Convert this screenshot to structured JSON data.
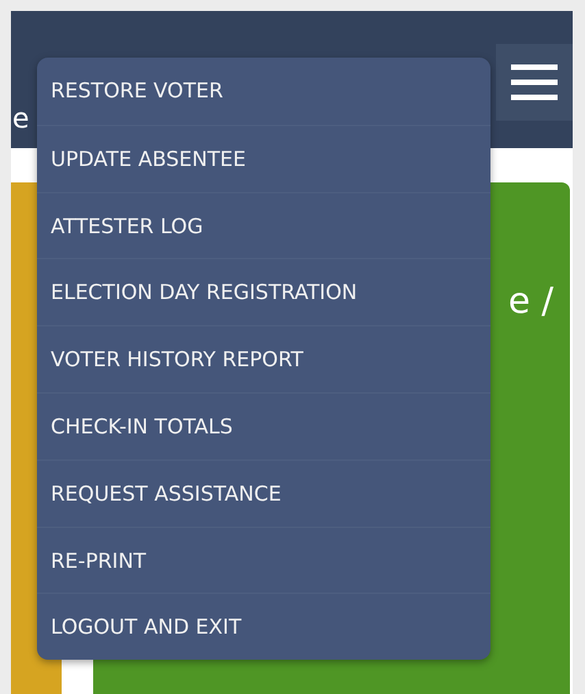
{
  "header": {
    "title_fragment": "e"
  },
  "content": {
    "card_text_fragment": "e /"
  },
  "menu": {
    "items": [
      {
        "label": "RESTORE VOTER"
      },
      {
        "label": "UPDATE ABSENTEE"
      },
      {
        "label": "ATTESTER LOG"
      },
      {
        "label": "ELECTION DAY REGISTRATION"
      },
      {
        "label": "VOTER HISTORY REPORT"
      },
      {
        "label": "CHECK-IN TOTALS"
      },
      {
        "label": "REQUEST ASSISTANCE"
      },
      {
        "label": "RE-PRINT"
      },
      {
        "label": "LOGOUT AND EXIT"
      }
    ]
  }
}
